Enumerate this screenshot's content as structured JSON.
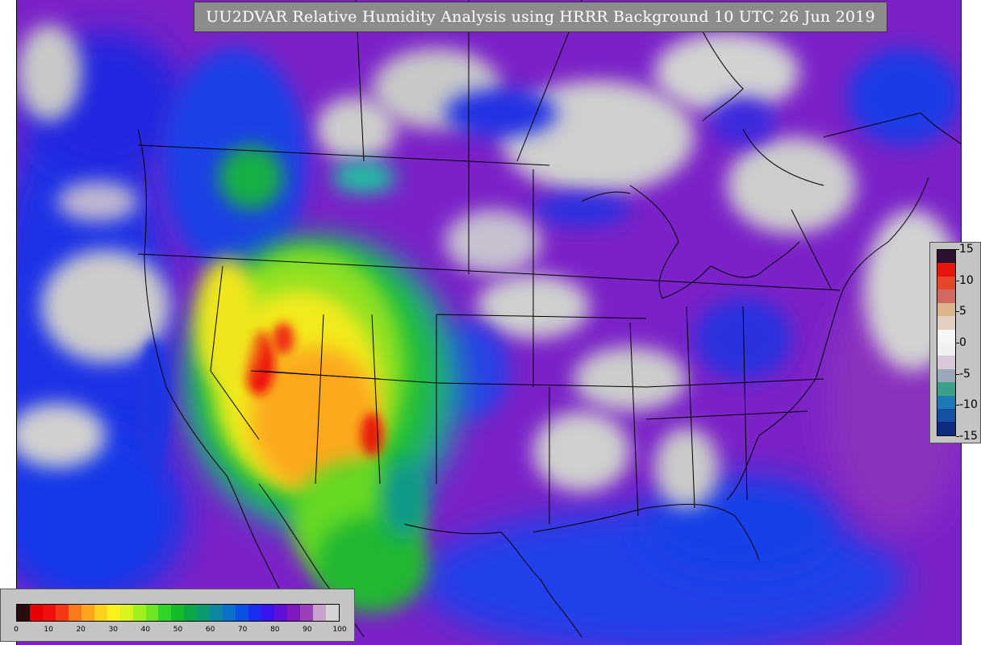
{
  "title": "UU2DVAR Relative Humidity Analysis using HRRR Background 10 UTC 26 Jun 2019",
  "increment_legend": {
    "ticks": [
      "15",
      "10",
      "5",
      "0",
      "-5",
      "-10",
      "-15"
    ],
    "colors": [
      "#2a1230",
      "#e8140e",
      "#e5472a",
      "#d06a60",
      "#dcb48c",
      "#e2cfc0",
      "#f6f6f6",
      "#f0f0f0",
      "#d8c8d8",
      "#9aa8b8",
      "#3aa08a",
      "#1e7ab4",
      "#1650a0",
      "#0c2c80"
    ]
  },
  "rh_legend": {
    "ticks": [
      "0",
      "10",
      "20",
      "30",
      "40",
      "50",
      "60",
      "70",
      "80",
      "90",
      "100"
    ],
    "colors": [
      "#2a0c0c",
      "#e80000",
      "#f01010",
      "#f43a14",
      "#f87a1a",
      "#fca61e",
      "#fcd21e",
      "#f8f21c",
      "#d8f41c",
      "#a0f01e",
      "#6ce622",
      "#30d426",
      "#12bc2a",
      "#0ca848",
      "#0c9a72",
      "#0c88a0",
      "#0c70c8",
      "#0a50e4",
      "#1a2ef2",
      "#3a14ee",
      "#6010d8",
      "#8018c0",
      "#9a40b8",
      "#c8a0cc",
      "#d4d4d4"
    ]
  }
}
